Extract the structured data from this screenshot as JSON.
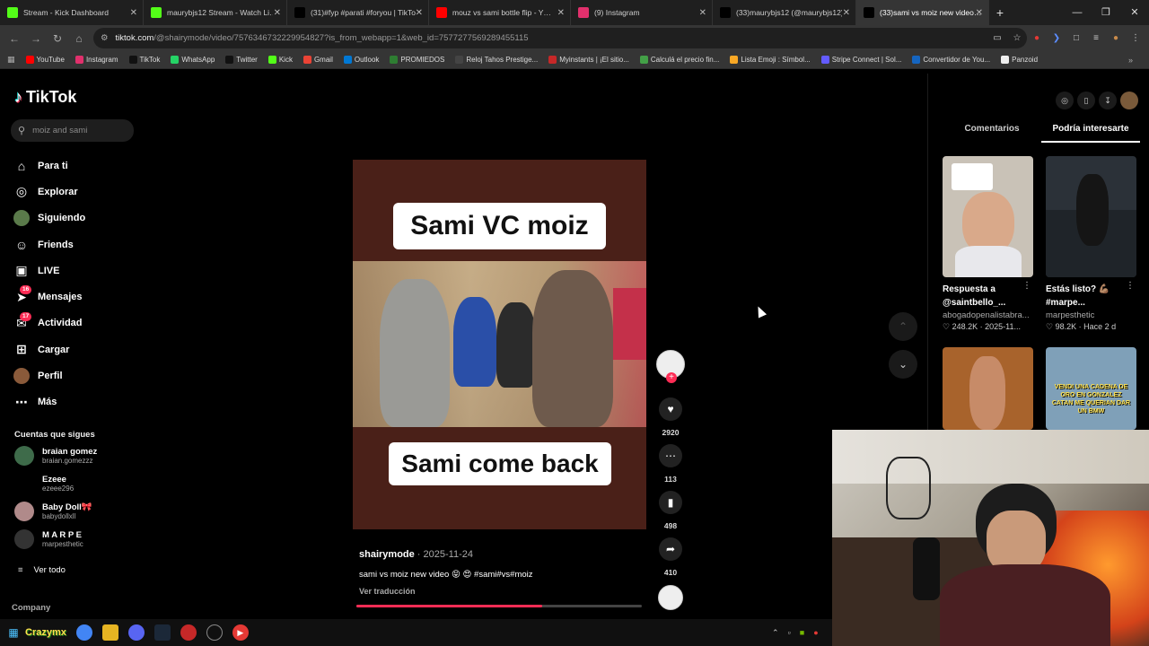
{
  "browser": {
    "tabs": [
      {
        "title": "Stream - Kick Dashboard",
        "icon": "kick-icon",
        "color": "#53fc18",
        "active": false
      },
      {
        "title": "maurybjs12 Stream - Watch Li…",
        "icon": "kick-icon",
        "color": "#53fc18",
        "active": false
      },
      {
        "title": "(31)#fyp #parati #foryou | TikTo…",
        "icon": "tiktok-icon",
        "color": "#000000",
        "active": false
      },
      {
        "title": "mouz vs sami bottle flip - Y…",
        "icon": "youtube-icon",
        "color": "#ff0000",
        "active": false
      },
      {
        "title": "(9) Instagram",
        "icon": "instagram-icon",
        "color": "#e1306c",
        "active": false
      },
      {
        "title": "(33)maurybjs12 (@maurybjs12)…",
        "icon": "tiktok-icon",
        "color": "#000000",
        "active": false
      },
      {
        "title": "(33)sami vs moiz new video…",
        "icon": "tiktok-icon",
        "color": "#000000",
        "active": true
      }
    ],
    "url_host": "tiktok.com",
    "url_path": "/@shairymode/video/7576346732229954827?is_from_webapp=1&web_id=7577277569289455115",
    "bookmarks": [
      {
        "label": "YouTube",
        "color": "#ff0000"
      },
      {
        "label": "Instagram",
        "color": "#e1306c"
      },
      {
        "label": "TikTok",
        "color": "#111111"
      },
      {
        "label": "WhatsApp",
        "color": "#25d366"
      },
      {
        "label": "Twitter",
        "color": "#111111"
      },
      {
        "label": "Kick",
        "color": "#53fc18"
      },
      {
        "label": "Gmail",
        "color": "#ea4335"
      },
      {
        "label": "Outlook",
        "color": "#0078d4"
      },
      {
        "label": "PROMIEDOS",
        "color": "#2e7d32"
      },
      {
        "label": "Reloj Tahos Prestige...",
        "color": "#444444"
      },
      {
        "label": "Myinstants | ¡El sitio...",
        "color": "#c62828"
      },
      {
        "label": "Calculá el precio fin...",
        "color": "#43a047"
      },
      {
        "label": "Lista Emoji : Símbol...",
        "color": "#f9a825"
      },
      {
        "label": "Stripe Connect | Sol...",
        "color": "#635bff"
      },
      {
        "label": "Convertidor de You...",
        "color": "#1565c0"
      },
      {
        "label": "Panzoid",
        "color": "#eeeeee"
      }
    ]
  },
  "tiktok": {
    "logo": "TikTok",
    "search_value": "moiz and sami",
    "nav": [
      {
        "label": "Para ti",
        "icon": "home-icon",
        "badge": ""
      },
      {
        "label": "Explorar",
        "icon": "compass-icon",
        "badge": ""
      },
      {
        "label": "Siguiendo",
        "icon": "avatar-icon",
        "badge": ""
      },
      {
        "label": "Friends",
        "icon": "friends-icon",
        "badge": ""
      },
      {
        "label": "LIVE",
        "icon": "live-icon",
        "badge": ""
      },
      {
        "label": "Mensajes",
        "icon": "send-icon",
        "badge": "16"
      },
      {
        "label": "Actividad",
        "icon": "inbox-icon",
        "badge": "17"
      },
      {
        "label": "Cargar",
        "icon": "plus-square-icon",
        "badge": ""
      },
      {
        "label": "Perfil",
        "icon": "profile-avatar-icon",
        "badge": ""
      },
      {
        "label": "Más",
        "icon": "more-icon",
        "badge": ""
      }
    ],
    "following_title": "Cuentas que sigues",
    "following": [
      {
        "name": "braian gomez",
        "handle": "braian.gomezzz",
        "color": "#3e6b4a"
      },
      {
        "name": "Ezeee",
        "handle": "ezeee296",
        "color": "#000000"
      },
      {
        "name": "Baby Doll🎀",
        "handle": "babydollxll",
        "color": "#b08a8a"
      },
      {
        "name": "M A R P E",
        "handle": "marpesthetic",
        "color": "#333333"
      }
    ],
    "see_all": "Ver todo",
    "company": "Company"
  },
  "video": {
    "caption_top": "Sami VC moiz",
    "caption_bottom": "Sami come back",
    "author": "shairymode",
    "date": "2025-11-24",
    "description": "sami vs moiz new video 😝 😍 #sami#vs#moiz",
    "translate": "Ver traducción",
    "progress": 0.65,
    "likes": "2920",
    "comments": "113",
    "saves": "498",
    "shares": "410"
  },
  "right_panel": {
    "tabs": [
      "Comentarios",
      "Podría interesarte"
    ],
    "active_tab": "Podría interesarte",
    "cards": [
      {
        "title": "Respuesta a @saintbello_...",
        "author": "abogadopenalistabra...",
        "likes": "248.2K",
        "date": "2025-11...",
        "thumb_color": "#c9c2b7"
      },
      {
        "title": "Estás listo? 💪🏽 #marpe...",
        "author": "marpesthetic",
        "likes": "98.2K",
        "date": "Hace 2 d",
        "thumb_color": "#2b3138"
      },
      {
        "title": "",
        "author": "",
        "likes": "",
        "date": "",
        "thumb_color": "#a8632c"
      },
      {
        "title": "",
        "author": "",
        "likes": "",
        "date": "",
        "thumb_color": "#7fa0b8"
      }
    ],
    "card4_text": "VENDI UNA CADENA DE ORO EN GONZALEZ CATAN ME QUERIAN DAR UN BMW"
  },
  "taskbar": {
    "user_label": "Crazymx"
  }
}
